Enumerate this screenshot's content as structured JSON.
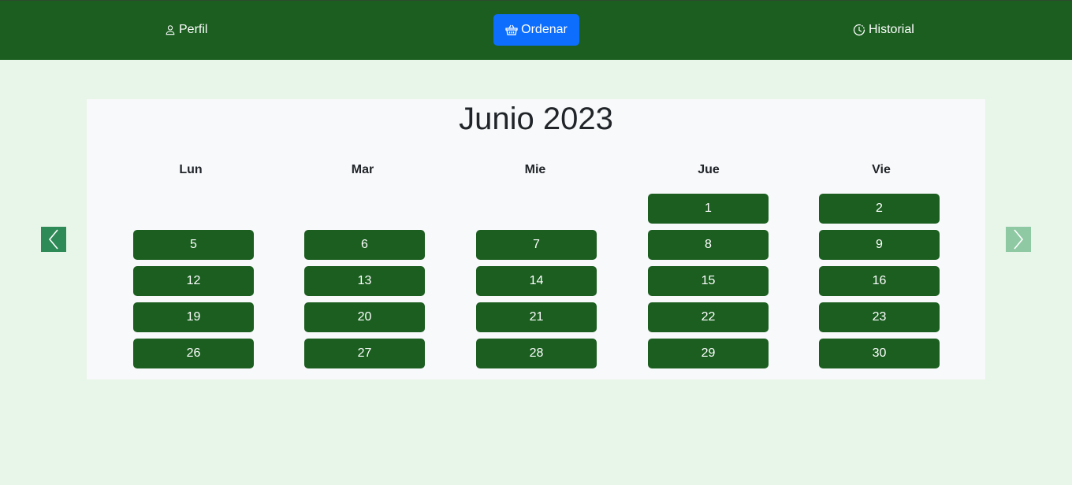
{
  "nav": {
    "perfil": "Perfil",
    "ordenar": "Ordenar",
    "historial": "Historial"
  },
  "calendar": {
    "title": "Junio 2023",
    "weekdays": [
      "Lun",
      "Mar",
      "Mie",
      "Jue",
      "Vie"
    ],
    "weeks": [
      [
        "",
        "",
        "",
        "1",
        "2"
      ],
      [
        "5",
        "6",
        "7",
        "8",
        "9"
      ],
      [
        "12",
        "13",
        "14",
        "15",
        "16"
      ],
      [
        "19",
        "20",
        "21",
        "22",
        "23"
      ],
      [
        "26",
        "27",
        "28",
        "29",
        "30"
      ]
    ]
  },
  "icons": {
    "perfil": "person-icon",
    "ordenar": "basket-icon",
    "historial": "clock-history-icon",
    "prev": "chevron-left-icon",
    "next": "chevron-right-icon"
  },
  "colors": {
    "navbar": "#1b5e20",
    "page_background": "#e8f5e9",
    "active_nav": "#0d6efd",
    "day_button": "#1b5e20",
    "prev_arrow": "#2e8b57",
    "next_arrow": "#8fc9a3"
  }
}
